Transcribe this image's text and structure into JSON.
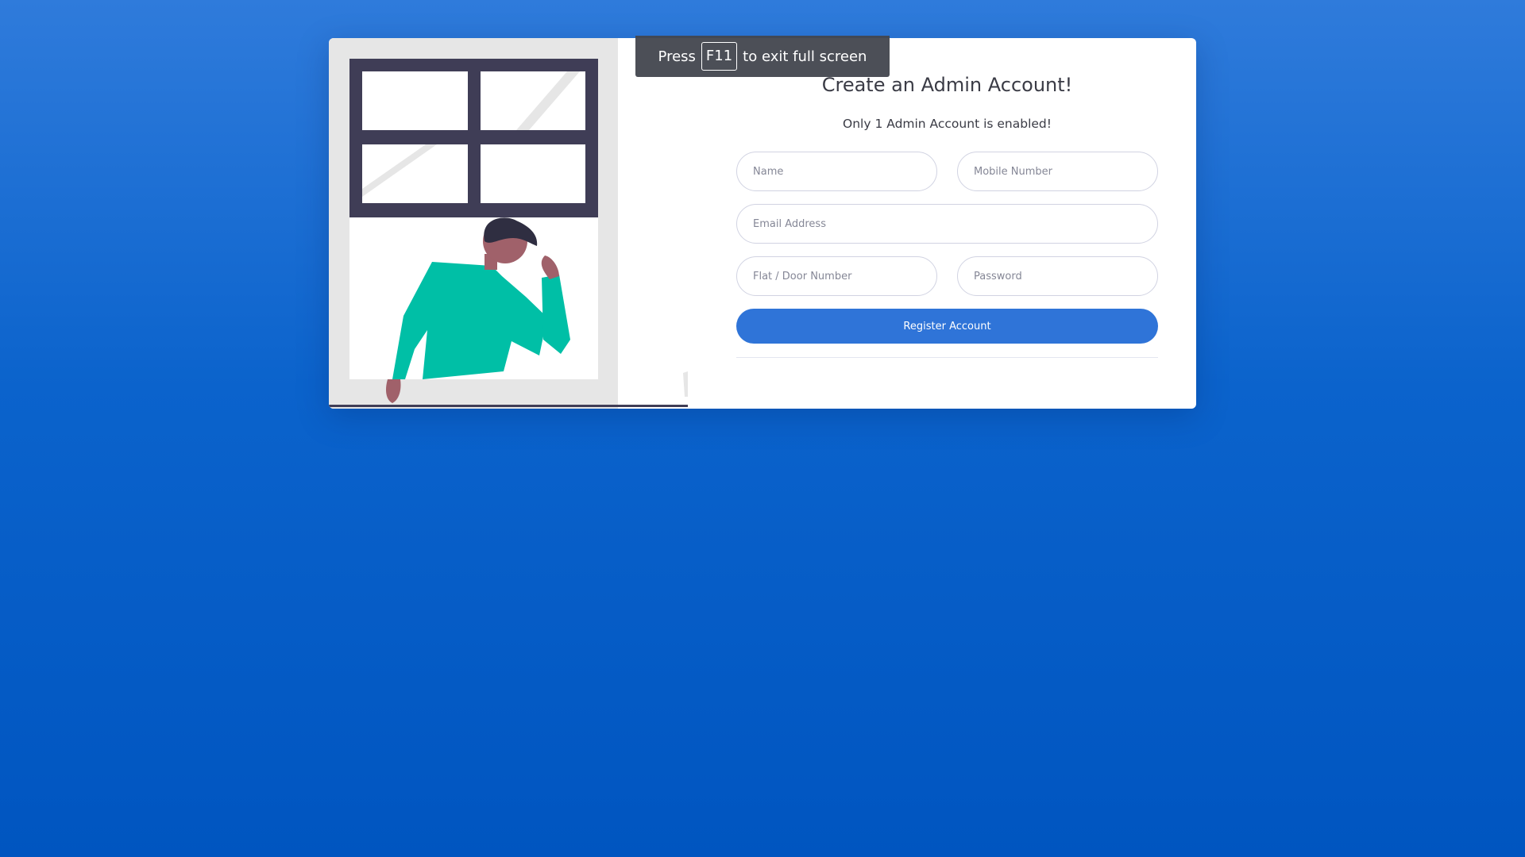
{
  "fullscreen_toast": {
    "prefix": "Press",
    "key": "F11",
    "suffix": "to exit full screen"
  },
  "illustration": {
    "icon": "person-at-window-illustration",
    "colors": {
      "panel_bg": "#e6e6e6",
      "window_frame": "#3f3d56",
      "shirt": "#00bfa6",
      "skin": "#a0616a",
      "hair": "#2f2e41"
    }
  },
  "form": {
    "title": "Create an Admin Account!",
    "subtitle": "Only 1 Admin Account is enabled!",
    "fields": {
      "name_placeholder": "Name",
      "mobile_placeholder": "Mobile Number",
      "email_placeholder": "Email Address",
      "flat_placeholder": "Flat / Door Number",
      "password_placeholder": "Password"
    },
    "register_label": "Register Account"
  },
  "colors": {
    "background_top": "#2f7bdb",
    "background_bottom": "#0055c0",
    "primary": "#2f74d8"
  }
}
